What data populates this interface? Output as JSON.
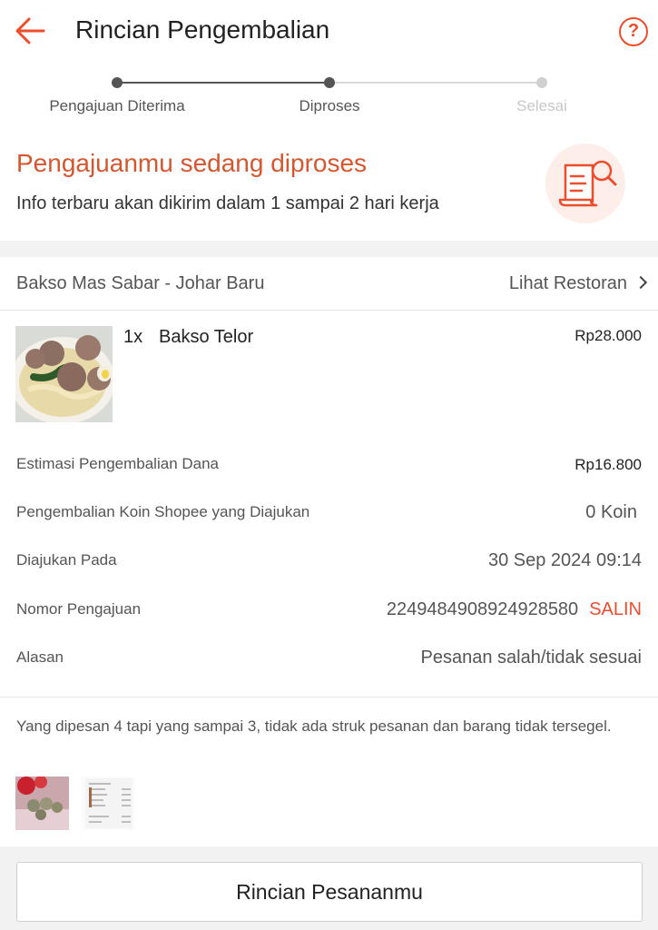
{
  "header": {
    "title": "Rincian Pengembalian",
    "help_icon": "question-circle-icon",
    "back_icon": "arrow-left-icon",
    "accent_color": "#ee4d2d"
  },
  "steps": [
    {
      "label": "Pengajuan Diterima",
      "state": "done"
    },
    {
      "label": "Diproses",
      "state": "current"
    },
    {
      "label": "Selesai",
      "state": "pending"
    }
  ],
  "status": {
    "title": "Pengajuanmu sedang diproses",
    "subtitle": "Info terbaru akan dikirim dalam 1 sampai 2 hari kerja",
    "illustration_icon": "document-search-icon"
  },
  "restaurant": {
    "name": "Bakso Mas Sabar - Johar Baru",
    "link_label": "Lihat Restoran"
  },
  "item": {
    "qty": "1x",
    "name": "Bakso Telor",
    "price": "Rp28.000"
  },
  "details": [
    {
      "label": "Estimasi Pengembalian Dana",
      "value": "Rp16.800"
    },
    {
      "label": "Pengembalian Koin Shopee yang Diajukan",
      "value": "0 Koin"
    },
    {
      "label": "Diajukan Pada",
      "value": "30 Sep 2024 09:14"
    },
    {
      "label": "Nomor Pengajuan",
      "value": "2249484908924928580",
      "action": "SALIN"
    },
    {
      "label": "Alasan",
      "value": "Pesanan salah/tidak sesuai"
    }
  ],
  "note": "Yang dipesan 4 tapi yang sampai 3, tidak ada struk pesanan dan barang tidak tersegel.",
  "footer": {
    "button_label": "Rincian Pesananmu"
  }
}
